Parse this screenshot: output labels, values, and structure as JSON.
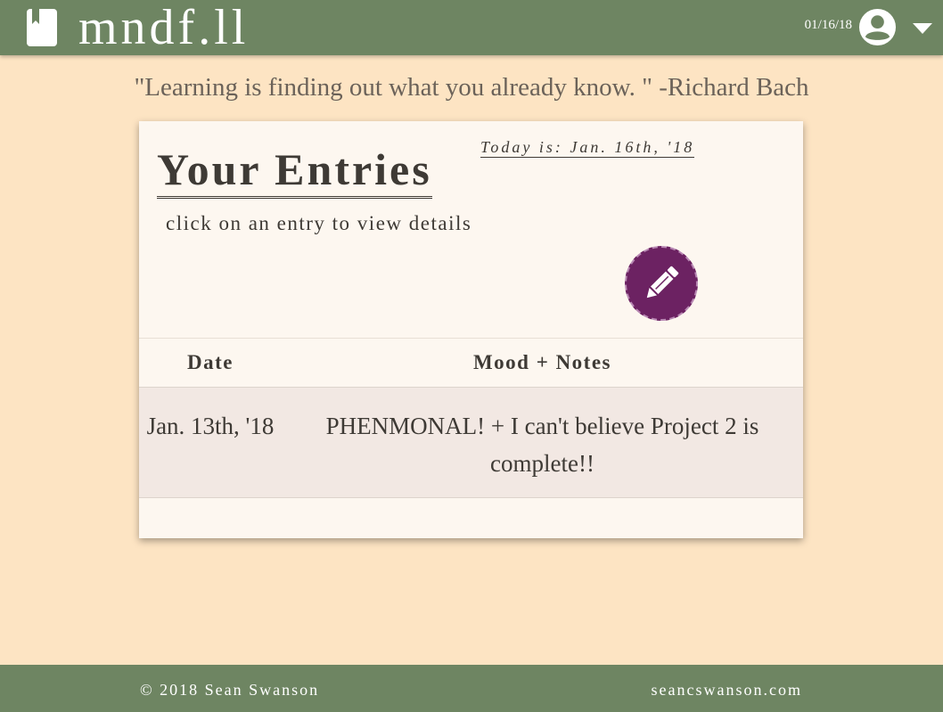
{
  "header": {
    "brand": "mndf.ll",
    "brand_icon": "bookmark-icon",
    "date": "01/16/18",
    "avatar_icon": "account-circle-icon",
    "menu_icon": "caret-down-icon"
  },
  "quote": "\"Learning is finding out what you already know. \" -Richard Bach",
  "card": {
    "title": "Your Entries",
    "subtitle": "click on an entry to view details",
    "today": "Today is: Jan. 16th, '18",
    "new_entry_icon": "pencil-icon",
    "columns": {
      "date": "Date",
      "notes": "Mood + Notes"
    },
    "entries": [
      {
        "date": "Jan. 13th, '18",
        "notes": "PHENMONAL! + I can't believe Project 2 is complete!!"
      }
    ]
  },
  "footer": {
    "copyright": "© 2018 Sean Swanson",
    "link": "seancswanson.com"
  },
  "colors": {
    "nav": "#6e8562",
    "background": "#fde4c3",
    "card": "#fdf7f0",
    "accent": "#6c2262",
    "row": "#f2e8e3"
  }
}
